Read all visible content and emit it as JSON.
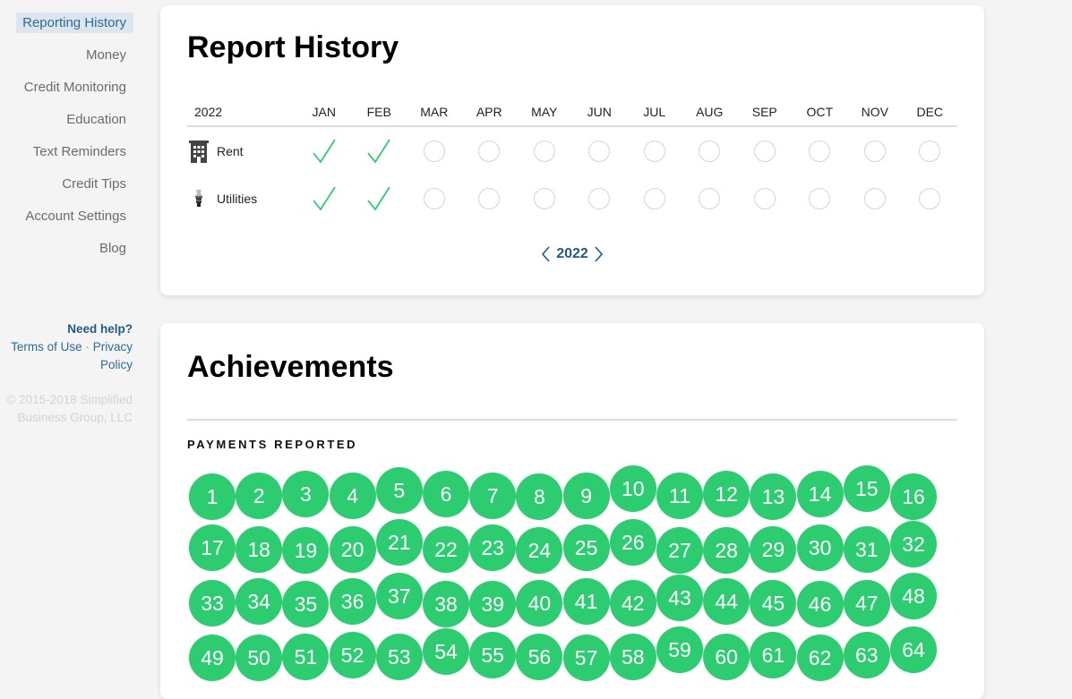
{
  "sidebar": {
    "items": [
      {
        "label": "Reporting History",
        "active": true
      },
      {
        "label": "Money"
      },
      {
        "label": "Credit Monitoring"
      },
      {
        "label": "Education"
      },
      {
        "label": "Text Reminders"
      },
      {
        "label": "Credit Tips"
      },
      {
        "label": "Account Settings"
      },
      {
        "label": "Blog"
      }
    ],
    "help_title": "Need help?",
    "terms": "Terms of Use",
    "separator": "·",
    "privacy_1": "Privacy",
    "privacy_2": "Policy",
    "copyright_1": "© 2015-2018 Simplified",
    "copyright_2": "Business Group, LLC"
  },
  "report": {
    "title": "Report History",
    "year_label": "2022",
    "months": [
      "JAN",
      "FEB",
      "MAR",
      "APR",
      "MAY",
      "JUN",
      "JUL",
      "AUG",
      "SEP",
      "OCT",
      "NOV",
      "DEC"
    ],
    "rows": [
      {
        "label": "Rent",
        "icon": "building-icon",
        "status": [
          "reported",
          "reported",
          "empty",
          "empty",
          "empty",
          "empty",
          "empty",
          "empty",
          "empty",
          "empty",
          "empty",
          "empty"
        ]
      },
      {
        "label": "Utilities",
        "icon": "lightbulb-icon",
        "status": [
          "reported",
          "reported",
          "empty",
          "empty",
          "empty",
          "empty",
          "empty",
          "empty",
          "empty",
          "empty",
          "empty",
          "empty"
        ]
      }
    ],
    "nav_year": "2022",
    "check_color": "#2ecc71"
  },
  "achievements": {
    "title": "Achievements",
    "subhead": "PAYMENTS REPORTED",
    "badge_color": "#2ecc71",
    "badges": [
      "1",
      "2",
      "3",
      "4",
      "5",
      "6",
      "7",
      "8",
      "9",
      "10",
      "11",
      "12",
      "13",
      "14",
      "15",
      "16",
      "17",
      "18",
      "19",
      "20",
      "21",
      "22",
      "23",
      "24",
      "25",
      "26",
      "27",
      "28",
      "29",
      "30",
      "31",
      "32",
      "33",
      "34",
      "35",
      "36",
      "37",
      "38",
      "39",
      "40",
      "41",
      "42",
      "43",
      "44",
      "45",
      "46",
      "47",
      "48",
      "49",
      "50",
      "51",
      "52",
      "53",
      "54",
      "55",
      "56",
      "57",
      "58",
      "59",
      "60",
      "61",
      "62",
      "63",
      "64"
    ]
  }
}
